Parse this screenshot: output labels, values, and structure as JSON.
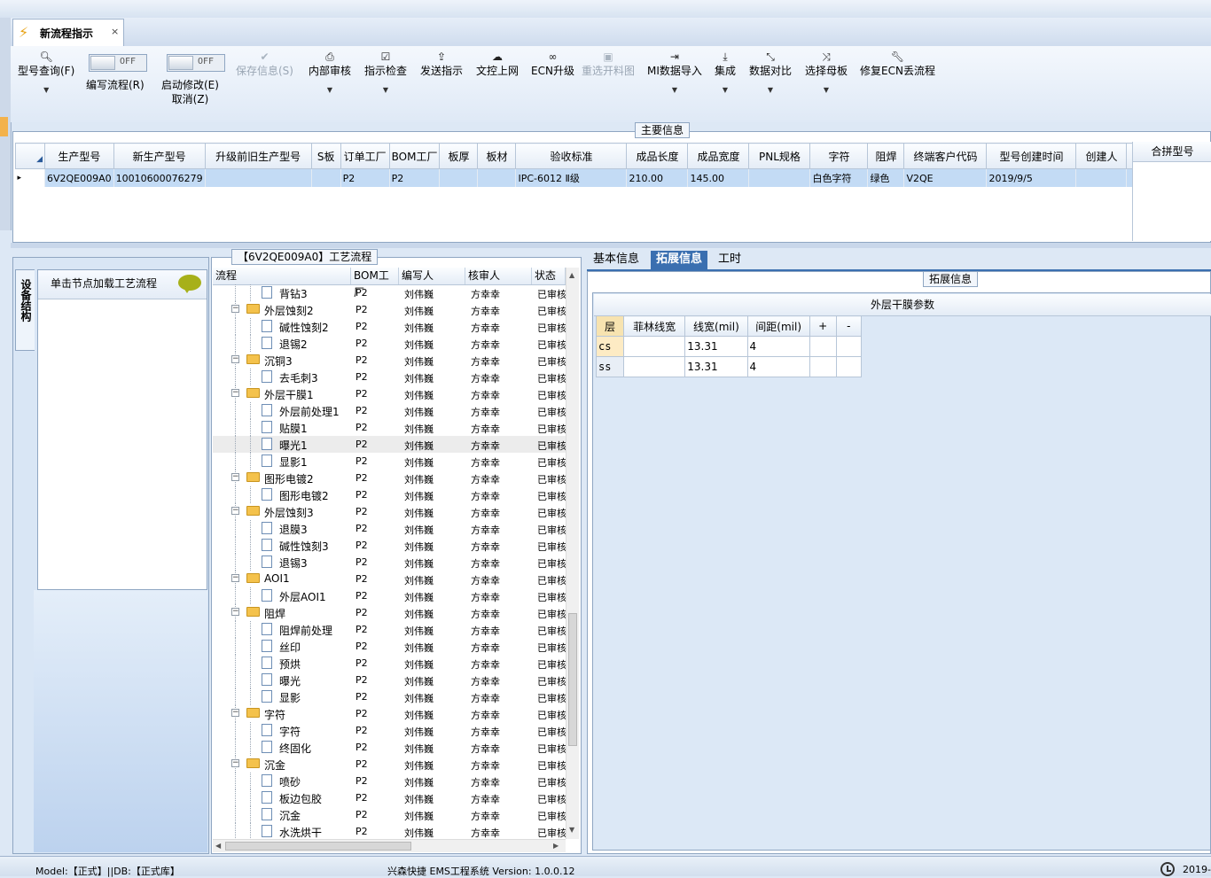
{
  "tab": {
    "title": "新流程指示",
    "close": "×"
  },
  "toolbar": {
    "query": "型号查询(F)",
    "write_flow": "编写流程(R)",
    "start_edit": "启动修改(E)",
    "cancel": "取消(Z)",
    "toggle_off": "OFF",
    "save": "保存信息(S)",
    "internal_review": "内部审核",
    "instruction_check": "指示检查",
    "send_instruction": "发送指示",
    "doc_upload": "文控上网",
    "ecn_upgrade": "ECN升级",
    "reselect_cut": "重选开料图",
    "mi_import": "MI数据导入",
    "integrate": "集成",
    "data_compare": "数据对比",
    "select_master": "选择母板",
    "repair_ecn": "修复ECN丢流程"
  },
  "main_info": {
    "title": "主要信息",
    "columns": [
      "生产型号",
      "新生产型号",
      "升级前旧生产型号",
      "S板",
      "订单工厂",
      "BOM工厂",
      "板厚",
      "板材",
      "验收标准",
      "成品长度",
      "成品宽度",
      "PNL规格",
      "字符",
      "阻焊",
      "终端客户代码",
      "型号创建时间",
      "创建人"
    ],
    "row": [
      "6V2QE009A0",
      "10010600076279",
      "",
      "",
      "P2",
      "P2",
      "",
      "",
      "IPC-6012 Ⅱ级",
      "210.00",
      "145.00",
      "",
      "白色字符",
      "绿色",
      "V2QE",
      "2019/9/5",
      ""
    ],
    "merge_title": "合拼型号"
  },
  "device": {
    "vtab": "设备结构",
    "hint": "单击节点加载工艺流程"
  },
  "process": {
    "title": "【6V2QE009A0】工艺流程",
    "columns": [
      "流程",
      "BOM工厂",
      "编写人",
      "核审人",
      "状态"
    ],
    "bom": "P2",
    "writer": "刘伟巍",
    "reviewer": "方幸幸",
    "status": "已审核",
    "rows": [
      {
        "name": "背钻3",
        "lvl": 2
      },
      {
        "name": "外层蚀刻2",
        "lvl": 1
      },
      {
        "name": "碱性蚀刻2",
        "lvl": 2
      },
      {
        "name": "退锡2",
        "lvl": 2
      },
      {
        "name": "沉铜3",
        "lvl": 1
      },
      {
        "name": "去毛刺3",
        "lvl": 2
      },
      {
        "name": "外层干膜1",
        "lvl": 1
      },
      {
        "name": "外层前处理1",
        "lvl": 2
      },
      {
        "name": "贴膜1",
        "lvl": 2
      },
      {
        "name": "曝光1",
        "lvl": 2
      },
      {
        "name": "显影1",
        "lvl": 2
      },
      {
        "name": "图形电镀2",
        "lvl": 1
      },
      {
        "name": "图形电镀2",
        "lvl": 2
      },
      {
        "name": "外层蚀刻3",
        "lvl": 1
      },
      {
        "name": "退膜3",
        "lvl": 2
      },
      {
        "name": "碱性蚀刻3",
        "lvl": 2
      },
      {
        "name": "退锡3",
        "lvl": 2
      },
      {
        "name": "AOI1",
        "lvl": 1
      },
      {
        "name": "外层AOI1",
        "lvl": 2
      },
      {
        "name": "阻焊",
        "lvl": 1
      },
      {
        "name": "阻焊前处理",
        "lvl": 2
      },
      {
        "name": "丝印",
        "lvl": 2
      },
      {
        "name": "预烘",
        "lvl": 2
      },
      {
        "name": "曝光",
        "lvl": 2
      },
      {
        "name": "显影",
        "lvl": 2
      },
      {
        "name": "字符",
        "lvl": 1
      },
      {
        "name": "字符",
        "lvl": 2
      },
      {
        "name": "终固化",
        "lvl": 2
      },
      {
        "name": "沉金",
        "lvl": 1
      },
      {
        "name": "喷砂",
        "lvl": 2
      },
      {
        "name": "板边包胶",
        "lvl": 2
      },
      {
        "name": "沉金",
        "lvl": 2
      },
      {
        "name": "水洗烘干",
        "lvl": 2
      }
    ]
  },
  "right_tabs": [
    "基本信息",
    "拓展信息",
    "工时"
  ],
  "ext": {
    "title": "拓展信息",
    "film_title": "外层干膜参数",
    "columns": [
      "层",
      "菲林线宽",
      "线宽(mil)",
      "间距(mil)",
      "+",
      "-"
    ],
    "rows": [
      [
        "cs",
        "",
        "13.31",
        "4",
        "",
        ""
      ],
      [
        "ss",
        "",
        "13.31",
        "4",
        "",
        ""
      ]
    ]
  },
  "status": {
    "model": "Model:【正式】||DB:【正式库】",
    "system": "兴森快捷 EMS工程系统 Version: 1.0.0.12",
    "date": "2019-"
  }
}
